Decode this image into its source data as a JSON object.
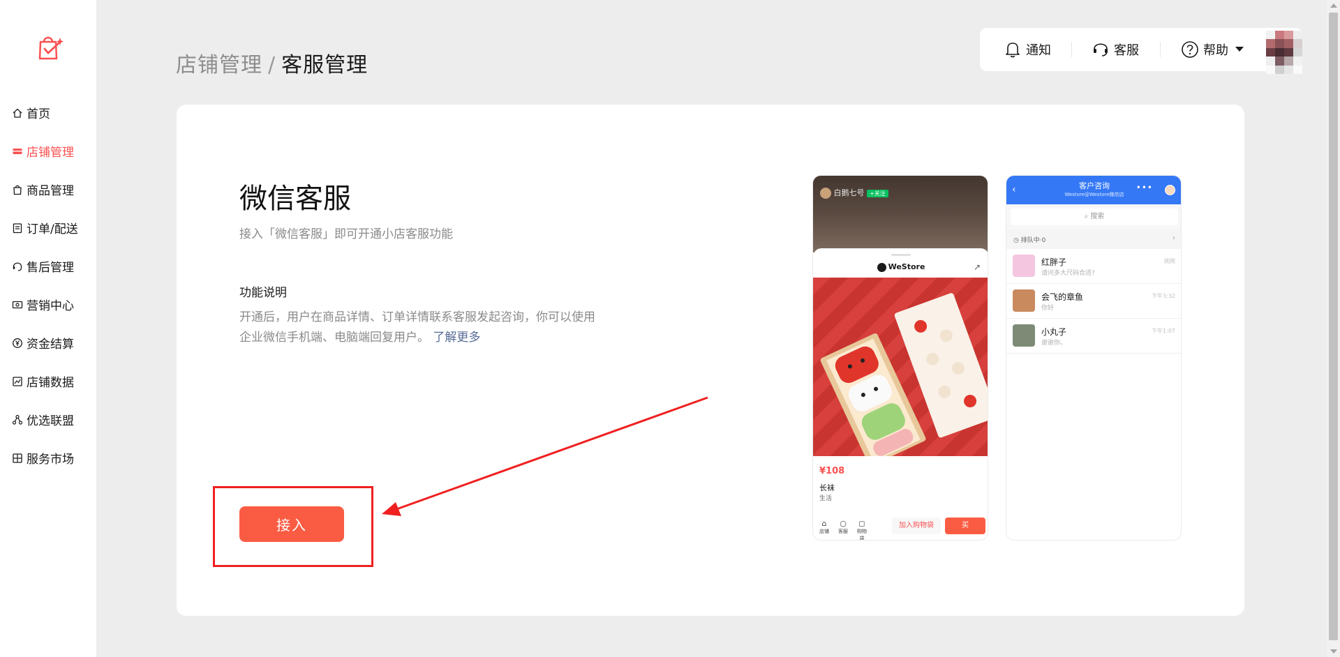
{
  "sidebar": {
    "items": [
      {
        "label": "首页",
        "icon": "home-icon"
      },
      {
        "label": "店铺管理",
        "icon": "store-icon",
        "active": true
      },
      {
        "label": "商品管理",
        "icon": "shopping-bag-icon"
      },
      {
        "label": "订单/配送",
        "icon": "order-icon"
      },
      {
        "label": "售后管理",
        "icon": "headset-icon"
      },
      {
        "label": "营销中心",
        "icon": "coupon-icon"
      },
      {
        "label": "资金结算",
        "icon": "yen-icon"
      },
      {
        "label": "店铺数据",
        "icon": "chart-icon"
      },
      {
        "label": "优选联盟",
        "icon": "network-icon"
      },
      {
        "label": "服务市场",
        "icon": "grid-icon"
      }
    ]
  },
  "breadcrumb": {
    "parent": "店铺管理",
    "separator": "/",
    "current": "客服管理"
  },
  "topbar": {
    "notify": "通知",
    "service": "客服",
    "help": "帮助"
  },
  "content": {
    "title": "微信客服",
    "subtitle": "接入「微信客服」即可开通小店客服功能",
    "feature_title": "功能说明",
    "feature_desc": "开通后，用户在商品详情、订单详情联系客服发起咨询，你可以使用企业微信手机端、电脑端回复用户。",
    "learn_more": "了解更多",
    "connect_button": "接入"
  },
  "preview_product": {
    "live_name": "白鹅七号",
    "live_follow": "+关注",
    "store_name": "WeStore",
    "price": "¥108",
    "product_name": "长袜",
    "category": "生活",
    "tabs": [
      "店铺",
      "客服",
      "购物袋"
    ],
    "add_to_cart": "加入购物袋",
    "buy": "买"
  },
  "preview_chat": {
    "title": "客户咨询",
    "subtitle": "Westore@Westore微信店",
    "search_placeholder": "搜索",
    "queue": "排队中·0",
    "chats": [
      {
        "name": "红胖子",
        "message": "请问多大尺码合适?",
        "time": "刚刚"
      },
      {
        "name": "会飞的章鱼",
        "message": "你好",
        "time": "下午3:32"
      },
      {
        "name": "小丸子",
        "message": "谢谢你。",
        "time": "下午1:07"
      }
    ]
  },
  "colors": {
    "accent": "#fa5151",
    "button": "#fa5c43",
    "link": "#576b95",
    "highlight_box": "#f02020",
    "chat_header": "#3478f6"
  }
}
